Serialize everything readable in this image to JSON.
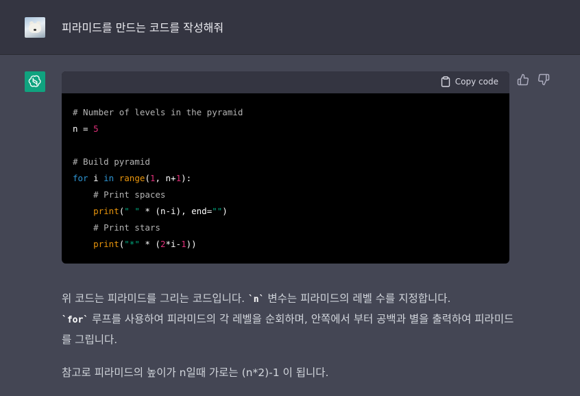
{
  "user": {
    "message": "피라미드를 만드는 코드를 작성해줘",
    "avatar_icon": "polar-bear-avatar"
  },
  "assistant": {
    "avatar_icon": "openai-logo-icon",
    "code_header": {
      "copy_label": "Copy code",
      "copy_icon": "clipboard-icon"
    },
    "code_lines": [
      "# Number of levels in the pyramid",
      "n = 5",
      "",
      "# Build pyramid",
      "for i in range(1, n+1):",
      "    # Print spaces",
      "    print(\" \" * (n-i), end=\"\")",
      "    # Print stars",
      "    print(\"*\" * (2*i-1))"
    ],
    "feedback": {
      "up_icon": "thumbs-up-icon",
      "down_icon": "thumbs-down-icon"
    },
    "paragraph1": {
      "t1": "위 코드는 피라미드를 그리는 코드입니다. ",
      "code1": "`n`",
      "t2": " 변수는 피라미드의 레벨 수를 지정합니다.",
      "code2": "`for`",
      "t3": " 루프를 사용하여 피라미드의 각 레벨을 순회하며, 안쪽에서 부터 공백과 별을 출력하여 피라미드를 그립니다."
    },
    "paragraph2": "참고로 피라미드의 높이가 n일때 가로는 (n*2)-1 이 됩니다."
  },
  "colors": {
    "page_bg": "#444654",
    "user_row_bg": "#343541",
    "code_bg": "#000000",
    "accent": "#10a37f"
  }
}
